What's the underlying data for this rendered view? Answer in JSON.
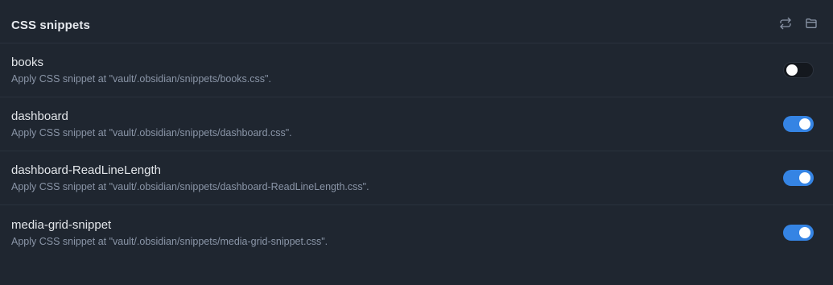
{
  "header": {
    "title": "CSS snippets",
    "actions": [
      {
        "icon": "reload-icon"
      },
      {
        "icon": "folder-icon"
      }
    ]
  },
  "snippets": [
    {
      "name": "books",
      "description": "Apply CSS snippet at \"vault/.obsidian/snippets/books.css\".",
      "enabled": false
    },
    {
      "name": "dashboard",
      "description": "Apply CSS snippet at \"vault/.obsidian/snippets/dashboard.css\".",
      "enabled": true
    },
    {
      "name": "dashboard-ReadLineLength",
      "description": "Apply CSS snippet at \"vault/.obsidian/snippets/dashboard-ReadLineLength.css\".",
      "enabled": true
    },
    {
      "name": "media-grid-snippet",
      "description": "Apply CSS snippet at \"vault/.obsidian/snippets/media-grid-snippet.css\".",
      "enabled": true
    }
  ],
  "colors": {
    "background": "#1f2630",
    "accent": "#3584e4",
    "icon": "#8a95a7"
  }
}
